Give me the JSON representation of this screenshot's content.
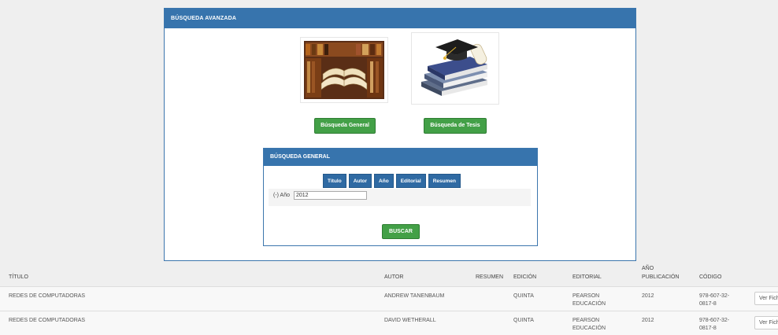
{
  "advanced_panel": {
    "title": "BÚSQUEDA AVANZADA"
  },
  "buttons": {
    "general": "Búsqueda General",
    "tesis": "Búsqueda de Tesis"
  },
  "general_panel": {
    "title": "BÚSQUEDA GENERAL",
    "tabs": [
      "Título",
      "Autor",
      "Año",
      "Editorial",
      "Resumen"
    ],
    "filter": {
      "label": "(-) Año",
      "value": "2012"
    },
    "search_button": "BUSCAR"
  },
  "icons": {
    "books": "open-books-image",
    "graduation": "graduation-cap-books-image"
  },
  "colors": {
    "primary": "#3774ad",
    "success": "#43a047"
  },
  "results": {
    "headers": {
      "titulo": "TÍTULO",
      "autor": "AUTOR",
      "resumen": "RESUMEN",
      "edicion": "EDICIÓN",
      "editorial": "EDITORIAL",
      "anio_line1": "AÑO",
      "anio_line2": "PUBLICACIÓN",
      "codigo": "CÓDIGO"
    },
    "rows": [
      {
        "titulo": "REDES DE COMPUTADORAS",
        "autor": "ANDREW TANENBAUM",
        "edicion": "QUINTA",
        "editorial_line1": "PEARSON",
        "editorial_line2": "EDUCACIÓN",
        "anio": "2012",
        "codigo_line1": "978-607-32-",
        "codigo_line2": "0817-8",
        "action": "Ver Ficha"
      },
      {
        "titulo": "REDES DE COMPUTADORAS",
        "autor": "DAVID WETHERALL",
        "edicion": "QUINTA",
        "editorial_line1": "PEARSON",
        "editorial_line2": "EDUCACIÓN",
        "anio": "2012",
        "codigo_line1": "978-607-32-",
        "codigo_line2": "0817-8",
        "action": "Ver Ficha"
      }
    ]
  }
}
